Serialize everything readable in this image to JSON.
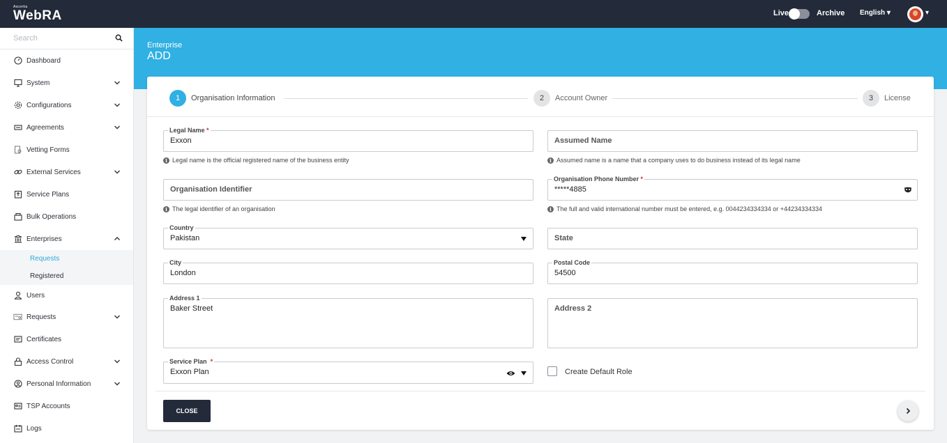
{
  "topbar": {
    "brand_small": "Ascertia",
    "brand": "WebRA",
    "live_label": "Live",
    "archive_label": "Archive",
    "language": "English ▾",
    "avatar_caret": "▾"
  },
  "sidebar": {
    "search_placeholder": "Search",
    "items": [
      {
        "label": "Dashboard"
      },
      {
        "label": "System"
      },
      {
        "label": "Configurations"
      },
      {
        "label": "Agreements"
      },
      {
        "label": "Vetting Forms"
      },
      {
        "label": "External Services"
      },
      {
        "label": "Service Plans"
      },
      {
        "label": "Bulk Operations"
      },
      {
        "label": "Enterprises"
      },
      {
        "label": "Users"
      },
      {
        "label": "Requests"
      },
      {
        "label": "Certificates"
      },
      {
        "label": "Access Control"
      },
      {
        "label": "Personal Information"
      },
      {
        "label": "TSP Accounts"
      },
      {
        "label": "Logs"
      }
    ],
    "enterprise_sub": [
      {
        "label": "Requests"
      },
      {
        "label": "Registered"
      }
    ]
  },
  "header": {
    "breadcrumb": "Enterprise",
    "title": "ADD"
  },
  "stepper": {
    "steps": [
      {
        "number": "1",
        "label": "Organisation Information"
      },
      {
        "number": "2",
        "label": "Account Owner"
      },
      {
        "number": "3",
        "label": "License"
      }
    ]
  },
  "form": {
    "legal_name": {
      "label": "Legal Name",
      "required": "*",
      "value": "Exxon",
      "hint": "Legal name is the official registered name of the business entity"
    },
    "assumed_name": {
      "placeholder": "Assumed Name",
      "hint": "Assumed name is a name that a company uses to do business instead of its legal name"
    },
    "org_identifier": {
      "placeholder": "Organisation Identifier",
      "hint": "The legal identifier of an organisation"
    },
    "phone": {
      "label": "Organisation Phone Number",
      "required": "*",
      "value": "*****4885",
      "hint": "The full and valid international number must be entered, e.g. 0044234334334 or +44234334334"
    },
    "country": {
      "label": "Country",
      "value": "Pakistan"
    },
    "state": {
      "placeholder": "State"
    },
    "city": {
      "label": "City",
      "value": "London"
    },
    "postal_code": {
      "label": "Postal Code",
      "value": "54500"
    },
    "address1": {
      "label": "Address 1",
      "value": "Baker Street"
    },
    "address2": {
      "placeholder": "Address 2"
    },
    "service_plan": {
      "label": "Service Plan",
      "required": "*",
      "value": "Exxon Plan"
    },
    "create_default_role": {
      "label": "Create Default Role",
      "checked": false
    },
    "info_glyph": "i"
  },
  "actions": {
    "close_label": "CLOSE"
  },
  "colors": {
    "topbar": "#232b3a",
    "accent": "#30b0e3",
    "required": "#d03030"
  }
}
